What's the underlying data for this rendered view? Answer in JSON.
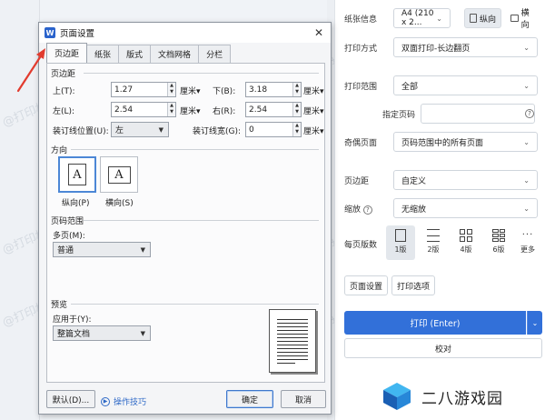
{
  "watermark": "@打印机卫士",
  "dialog": {
    "title": "页面设置",
    "app_icon": "W",
    "tabs": [
      "页边距",
      "纸张",
      "版式",
      "文档网格",
      "分栏"
    ],
    "margins": {
      "section": "页边距",
      "top_label": "上(T):",
      "top_value": "1.27",
      "bottom_label": "下(B):",
      "bottom_value": "3.18",
      "left_label": "左(L):",
      "left_value": "2.54",
      "right_label": "右(R):",
      "right_value": "2.54",
      "gutter_pos_label": "装订线位置(U):",
      "gutter_pos_value": "左",
      "gutter_width_label": "装订线宽(G):",
      "gutter_width_value": "0",
      "unit": "厘米"
    },
    "orientation": {
      "section": "方向",
      "portrait": "纵向(P)",
      "landscape": "横向(S)",
      "glyph": "A"
    },
    "page_range": {
      "section": "页码范围",
      "multi_label": "多页(M):",
      "multi_value": "普通"
    },
    "preview": {
      "section": "预览",
      "apply_label": "应用于(Y):",
      "apply_value": "整篇文档"
    },
    "buttons": {
      "default": "默认(D)...",
      "tips": "操作技巧",
      "ok": "确定",
      "cancel": "取消"
    }
  },
  "panel": {
    "paper_label": "纸张信息",
    "paper_value": "A4 (210 x 2...",
    "portrait": "纵向",
    "landscape": "横向",
    "print_mode_label": "打印方式",
    "print_mode_value": "双面打印-长边翻页",
    "range_label": "打印范围",
    "range_value": "全部",
    "specify_label": "指定页码",
    "odd_even_label": "奇偶页面",
    "odd_even_value": "页码范围中的所有页面",
    "margin_label": "页边距",
    "margin_value": "自定义",
    "zoom_label": "缩放",
    "zoom_value": "无缩放",
    "pps_label": "每页版数",
    "pps_options": [
      "1版",
      "2版",
      "4版",
      "6版",
      "更多"
    ],
    "page_setup_btn": "页面设置",
    "print_options_btn": "打印选项",
    "print_btn": "打印 (Enter)",
    "proof_btn": "校对"
  },
  "logo_text": "二八游戏园",
  "colors": {
    "accent": "#3270d9",
    "arrow": "#e23b2e"
  }
}
